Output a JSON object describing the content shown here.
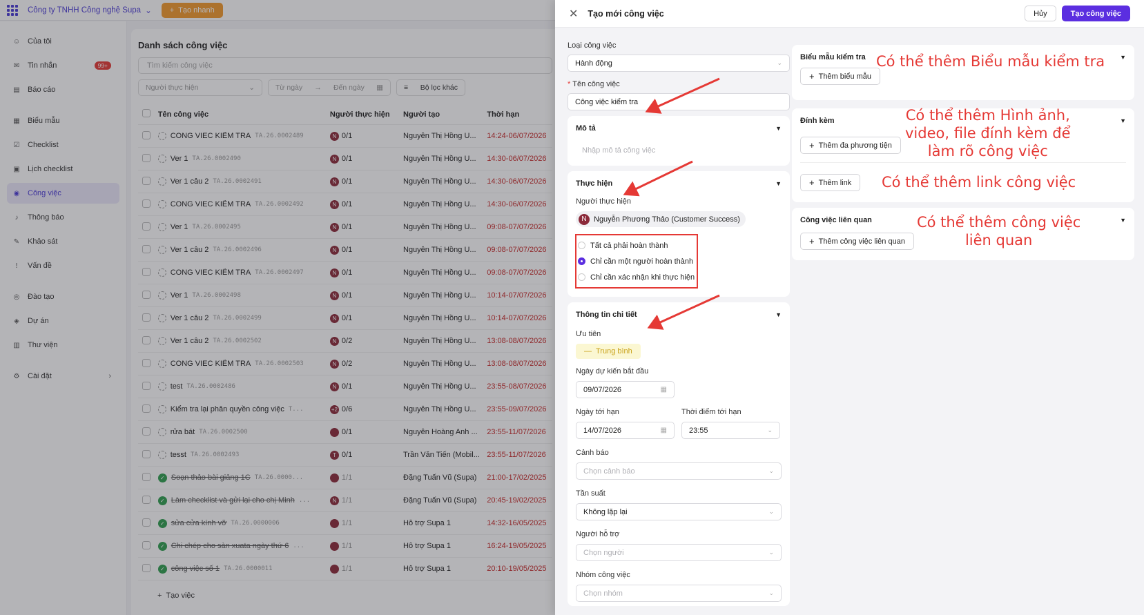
{
  "topbar": {
    "company": "Công ty TNHH Công nghệ Supa",
    "quick_create": "Tạo nhanh"
  },
  "sidebar": {
    "items": [
      {
        "label": "Của tôi",
        "icon": "user-icon"
      },
      {
        "label": "Tin nhắn",
        "icon": "message-icon",
        "badge": "99+"
      },
      {
        "label": "Báo cáo",
        "icon": "report-icon"
      },
      {
        "label": "Biểu mẫu",
        "icon": "form-icon"
      },
      {
        "label": "Checklist",
        "icon": "checklist-icon"
      },
      {
        "label": "Lịch checklist",
        "icon": "calendar-icon"
      },
      {
        "label": "Công việc",
        "icon": "task-icon",
        "active": true
      },
      {
        "label": "Thông báo",
        "icon": "bell-icon"
      },
      {
        "label": "Khảo sát",
        "icon": "survey-icon"
      },
      {
        "label": "Vấn đề",
        "icon": "issue-icon"
      },
      {
        "label": "Đào tạo",
        "icon": "training-icon"
      },
      {
        "label": "Dự án",
        "icon": "project-icon"
      },
      {
        "label": "Thư viện",
        "icon": "library-icon"
      },
      {
        "label": "Cài đặt",
        "icon": "settings-icon"
      }
    ]
  },
  "list": {
    "title": "Danh sách công việc",
    "search_placeholder": "Tìm kiếm công việc",
    "filter_assignee": "Người thực hiện",
    "filter_from": "Từ ngày",
    "filter_to": "Đến ngày",
    "filter_more": "Bộ lọc khác",
    "headers": [
      "Tên công việc",
      "Người thực hiện",
      "Người tạo",
      "Thời hạn"
    ],
    "rows": [
      {
        "name": "CONG VIEC KIỂM TRA",
        "code": "TA.26.0002489",
        "avatar": "N",
        "count": "0/1",
        "creator": "Nguyễn Thị Hồng U...",
        "due": "14:24-06/07/2026",
        "done": false
      },
      {
        "name": "Ver 1",
        "code": "TA.26.0002490",
        "avatar": "N",
        "count": "0/1",
        "creator": "Nguyễn Thị Hồng U...",
        "due": "14:30-06/07/2026",
        "done": false
      },
      {
        "name": "Ver 1 câu 2",
        "code": "TA.26.0002491",
        "avatar": "N",
        "count": "0/1",
        "creator": "Nguyễn Thị Hồng U...",
        "due": "14:30-06/07/2026",
        "done": false
      },
      {
        "name": "CONG VIEC KIỂM TRA",
        "code": "TA.26.0002492",
        "avatar": "N",
        "count": "0/1",
        "creator": "Nguyễn Thị Hồng U...",
        "due": "14:30-06/07/2026",
        "done": false
      },
      {
        "name": "Ver 1",
        "code": "TA.26.0002495",
        "avatar": "N",
        "count": "0/1",
        "creator": "Nguyễn Thị Hồng U...",
        "due": "09:08-07/07/2026",
        "done": false
      },
      {
        "name": "Ver 1 câu 2",
        "code": "TA.26.0002496",
        "avatar": "N",
        "count": "0/1",
        "creator": "Nguyễn Thị Hồng U...",
        "due": "09:08-07/07/2026",
        "done": false
      },
      {
        "name": "CONG VIEC KIỂM TRA",
        "code": "TA.26.0002497",
        "avatar": "N",
        "count": "0/1",
        "creator": "Nguyễn Thị Hồng U...",
        "due": "09:08-07/07/2026",
        "done": false
      },
      {
        "name": "Ver 1",
        "code": "TA.26.0002498",
        "avatar": "N",
        "count": "0/1",
        "creator": "Nguyễn Thị Hồng U...",
        "due": "10:14-07/07/2026",
        "done": false
      },
      {
        "name": "Ver 1 câu 2",
        "code": "TA.26.0002499",
        "avatar": "N",
        "count": "0/1",
        "creator": "Nguyễn Thị Hồng U...",
        "due": "10:14-07/07/2026",
        "done": false
      },
      {
        "name": "Ver 1 câu 2",
        "code": "TA.26.0002502",
        "avatar": "N",
        "count": "0/2",
        "creator": "Nguyễn Thị Hồng U...",
        "due": "13:08-08/07/2026",
        "done": false
      },
      {
        "name": "CONG VIEC KIỂM TRA",
        "code": "TA.26.0002503",
        "avatar": "N",
        "count": "0/2",
        "creator": "Nguyễn Thị Hồng U...",
        "due": "13:08-08/07/2026",
        "done": false
      },
      {
        "name": "test",
        "code": "TA.26.0002486",
        "avatar": "N",
        "count": "0/1",
        "creator": "Nguyễn Thị Hồng U...",
        "due": "23:55-08/07/2026",
        "done": false
      },
      {
        "name": "Kiểm tra lại phân quyền công việc",
        "code": "T...",
        "avatar": "+2",
        "count": "0/6",
        "creator": "Nguyễn Thị Hồng U...",
        "due": "23:55-09/07/2026",
        "done": false
      },
      {
        "name": "rửa bát",
        "code": "TA.26.0002500",
        "avatar": "",
        "count": "0/1",
        "creator": "Nguyễn Hoàng Anh ...",
        "due": "23:55-11/07/2026",
        "done": false
      },
      {
        "name": "tesst",
        "code": "TA.26.0002493",
        "avatar": "T",
        "count": "0/1",
        "creator": "Trần Văn Tiến (Mobil...",
        "due": "23:55-11/07/2026",
        "done": false
      },
      {
        "name": "Soạn thảo bài giảng 1C",
        "code": "TA.26.0000...",
        "avatar": "",
        "count": "1/1",
        "creator": "Đặng Tuấn Vũ (Supa)",
        "due": "21:00-17/02/2025",
        "done": true
      },
      {
        "name": "Làm checklist và gửi lại cho chị Minh",
        "code": "...",
        "avatar": "N",
        "count": "1/1",
        "creator": "Đặng Tuấn Vũ (Supa)",
        "due": "20:45-19/02/2025",
        "done": true
      },
      {
        "name": "sửa cửa kính vỡ",
        "code": "TA.26.0000006",
        "avatar": "",
        "count": "1/1",
        "creator": "Hỗ trợ Supa 1",
        "due": "14:32-16/05/2025",
        "done": true
      },
      {
        "name": "Chi chép cho sàn xuata ngày thứ 6",
        "code": "...",
        "avatar": "",
        "count": "1/1",
        "creator": "Hỗ trợ Supa 1",
        "due": "16:24-19/05/2025",
        "done": true
      },
      {
        "name": "công việc số 1",
        "code": "TA.26.0000011",
        "avatar": "",
        "count": "1/1",
        "creator": "Hỗ trợ Supa 1",
        "due": "20:10-19/05/2025",
        "done": true
      }
    ],
    "add_task": "Tạo việc"
  },
  "drawer": {
    "title": "Tạo mới công việc",
    "cancel": "Hủy",
    "create": "Tạo công việc",
    "type_label": "Loại công việc",
    "type_value": "Hành động",
    "name_label": "Tên công việc",
    "name_value": "Công việc kiểm tra",
    "desc_title": "Mô tả",
    "desc_placeholder": "Nhập mô tả công việc",
    "exec_title": "Thực hiện",
    "exec_assignee_label": "Người thực hiện",
    "exec_assignee_avatar": "N",
    "exec_assignee_name": "Nguyễn Phương Thảo (Customer Success)",
    "exec_options": [
      {
        "label": "Tất cả phải hoàn thành",
        "selected": false
      },
      {
        "label": "Chỉ cần một người hoàn thành",
        "selected": true
      },
      {
        "label": "Chỉ cần xác nhận khi thực hiện",
        "selected": false
      }
    ],
    "detail_title": "Thông tin chi tiết",
    "priority_label": "Ưu tiên",
    "priority_value": "Trung bình",
    "start_label": "Ngày dự kiến bắt đầu",
    "start_value": "09/07/2026",
    "due_label": "Ngày tới hạn",
    "due_value": "14/07/2026",
    "due_time_label": "Thời điểm tới hạn",
    "due_time_value": "23:55",
    "alert_label": "Cảnh báo",
    "alert_placeholder": "Chọn cảnh báo",
    "freq_label": "Tần suất",
    "freq_value": "Không lặp lại",
    "helper_label": "Người hỗ trợ",
    "helper_placeholder": "Chọn người",
    "group_label": "Nhóm công việc",
    "group_placeholder": "Chọn nhóm",
    "checkform_title": "Biểu mẫu kiểm tra",
    "checkform_btn": "Thêm biểu mẫu",
    "attach_title": "Đính kèm",
    "attach_media_btn": "Thêm đa phương tiện",
    "attach_link_btn": "Thêm link",
    "related_title": "Công việc liên quan",
    "related_btn": "Thêm công việc liên quan"
  },
  "annotations": {
    "note_checkform": "Có thể thêm Biểu mẫu kiểm tra",
    "note_attach_1": "Có thể thêm Hình ảnh,",
    "note_attach_2": "video, file đính kèm để",
    "note_attach_3": "làm rõ công việc",
    "note_link": "Có thể thêm link công việc",
    "note_related_1": "Có thể thêm công việc",
    "note_related_2": "liên quan",
    "color": "#e53935"
  },
  "colors": {
    "accent": "#5b2ee0",
    "quick": "#f39a2b",
    "overdue": "#c62828"
  }
}
